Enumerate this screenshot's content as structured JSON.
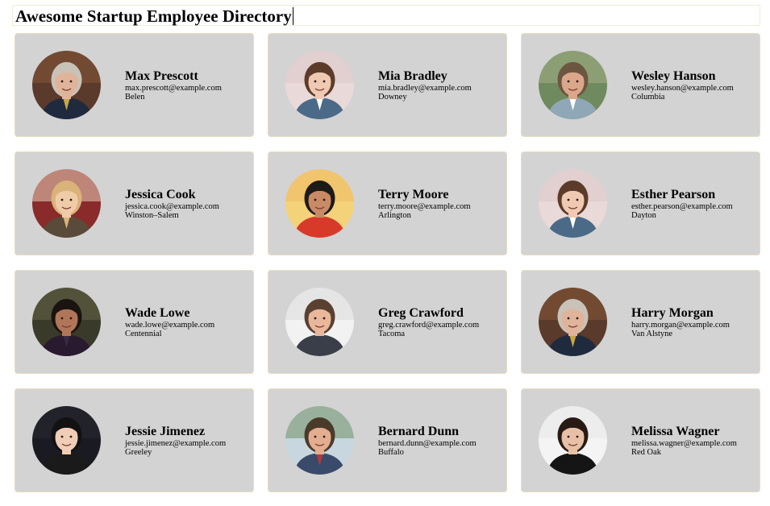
{
  "header": {
    "title": "Awesome Startup Employee Directory"
  },
  "employees": [
    {
      "name": "Max Prescott",
      "email": "max.prescott@example.com",
      "city": "Belen",
      "avatar": {
        "bg": "#5a3a2a",
        "bg2": "#8a5a3a",
        "skin": "#e0b49a",
        "hair": "#c9c2b8",
        "shirt": "#1f2a3f",
        "accent": "#c9a545"
      }
    },
    {
      "name": "Mia Bradley",
      "email": "mia.bradley@example.com",
      "city": "Downey",
      "avatar": {
        "bg": "#e9d9d8",
        "bg2": "#d9c7c6",
        "skin": "#f0c9b3",
        "hair": "#5c3b2a",
        "shirt": "#4a6a88",
        "accent": "#ffffff"
      }
    },
    {
      "name": "Wesley Hanson",
      "email": "wesley.hanson@example.com",
      "city": "Columbia",
      "avatar": {
        "bg": "#6f8a5e",
        "bg2": "#a9b48a",
        "skin": "#dba78a",
        "hair": "#6b5642",
        "shirt": "#8fa7b7",
        "accent": "#ffffff"
      }
    },
    {
      "name": "Jessica Cook",
      "email": "jessica.cook@example.com",
      "city": "Winston–Salem",
      "avatar": {
        "bg": "#8a2a2a",
        "bg2": "#f1e1c8",
        "skin": "#f0cba8",
        "hair": "#d9b37a",
        "shirt": "#5a4a3a",
        "accent": "#d9b37a"
      }
    },
    {
      "name": "Terry Moore",
      "email": "terry.moore@example.com",
      "city": "Arlington",
      "avatar": {
        "bg": "#f3d27a",
        "bg2": "#f0b860",
        "skin": "#c98a66",
        "hair": "#1e1a18",
        "shirt": "#d83a2a",
        "accent": "#d83a2a"
      }
    },
    {
      "name": "Esther Pearson",
      "email": "esther.pearson@example.com",
      "city": "Dayton",
      "avatar": {
        "bg": "#e9d9d8",
        "bg2": "#d9c7c6",
        "skin": "#f0c9b3",
        "hair": "#5c3b2a",
        "shirt": "#4a6a88",
        "accent": "#ffffff"
      }
    },
    {
      "name": "Wade Lowe",
      "email": "wade.lowe@example.com",
      "city": "Centennial",
      "avatar": {
        "bg": "#3a3a2a",
        "bg2": "#6a6a4a",
        "skin": "#b0765a",
        "hair": "#1a1410",
        "shirt": "#2a1a30",
        "accent": "#3a2a40"
      }
    },
    {
      "name": "Greg Crawford",
      "email": "greg.crawford@example.com",
      "city": "Tacoma",
      "avatar": {
        "bg": "#f2f2f2",
        "bg2": "#d8d8d8",
        "skin": "#e8b79c",
        "hair": "#5a4030",
        "shirt": "#3a3e48",
        "accent": "#3a3e48"
      }
    },
    {
      "name": "Harry Morgan",
      "email": "harry.morgan@example.com",
      "city": "Van Alstyne",
      "avatar": {
        "bg": "#5a3a2a",
        "bg2": "#8a5a3a",
        "skin": "#e0b49a",
        "hair": "#c9c2b8",
        "shirt": "#1f2a3f",
        "accent": "#c9a545"
      }
    },
    {
      "name": "Jessie Jimenez",
      "email": "jessie.jimenez@example.com",
      "city": "Greeley",
      "avatar": {
        "bg": "#1a1a22",
        "bg2": "#2a2a34",
        "skin": "#f0cdb6",
        "hair": "#121212",
        "shirt": "#1a1a1a",
        "accent": "#1a1a1a"
      }
    },
    {
      "name": "Bernard Dunn",
      "email": "bernard.dunn@example.com",
      "city": "Buffalo",
      "avatar": {
        "bg": "#c8d6df",
        "bg2": "#6a8a5a",
        "skin": "#e3ad8f",
        "hair": "#4a3a2a",
        "shirt": "#3a4a6a",
        "accent": "#b03a3a"
      }
    },
    {
      "name": "Melissa Wagner",
      "email": "melissa.wagner@example.com",
      "city": "Red Oak",
      "avatar": {
        "bg": "#f4f4f4",
        "bg2": "#e6e6e6",
        "skin": "#e8c0a6",
        "hair": "#2a1a14",
        "shirt": "#151515",
        "accent": "#151515"
      }
    }
  ]
}
